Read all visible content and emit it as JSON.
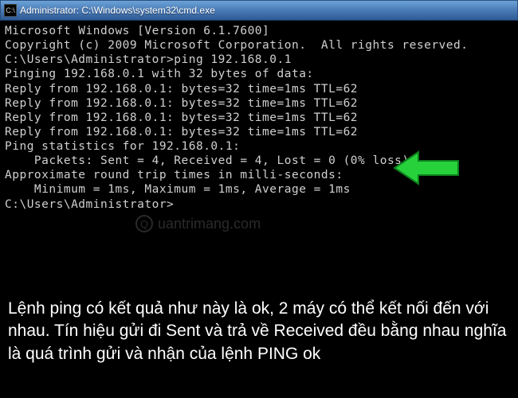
{
  "titlebar": {
    "title": "Administrator: C:\\Windows\\system32\\cmd.exe"
  },
  "terminal": {
    "lines": [
      "Microsoft Windows [Version 6.1.7600]",
      "Copyright (c) 2009 Microsoft Corporation.  All rights reserved.",
      "",
      "C:\\Users\\Administrator>ping 192.168.0.1",
      "",
      "Pinging 192.168.0.1 with 32 bytes of data:",
      "Reply from 192.168.0.1: bytes=32 time=1ms TTL=62",
      "Reply from 192.168.0.1: bytes=32 time=1ms TTL=62",
      "Reply from 192.168.0.1: bytes=32 time=1ms TTL=62",
      "Reply from 192.168.0.1: bytes=32 time=1ms TTL=62",
      "",
      "Ping statistics for 192.168.0.1:",
      "    Packets: Sent = 4, Received = 4, Lost = 0 (0% loss),",
      "Approximate round trip times in milli-seconds:",
      "    Minimum = 1ms, Maximum = 1ms, Average = 1ms",
      "",
      "C:\\Users\\Administrator>"
    ]
  },
  "watermark": {
    "text": "uantrimang.com"
  },
  "annotation": {
    "text": "Lệnh ping có kết quả như này là ok, 2 máy có thể kết nối đến với nhau. Tín hiệu gửi đi Sent và trả về Received đều bằng nhau nghĩa là quá trình gửi và nhận của lệnh PING ok"
  }
}
